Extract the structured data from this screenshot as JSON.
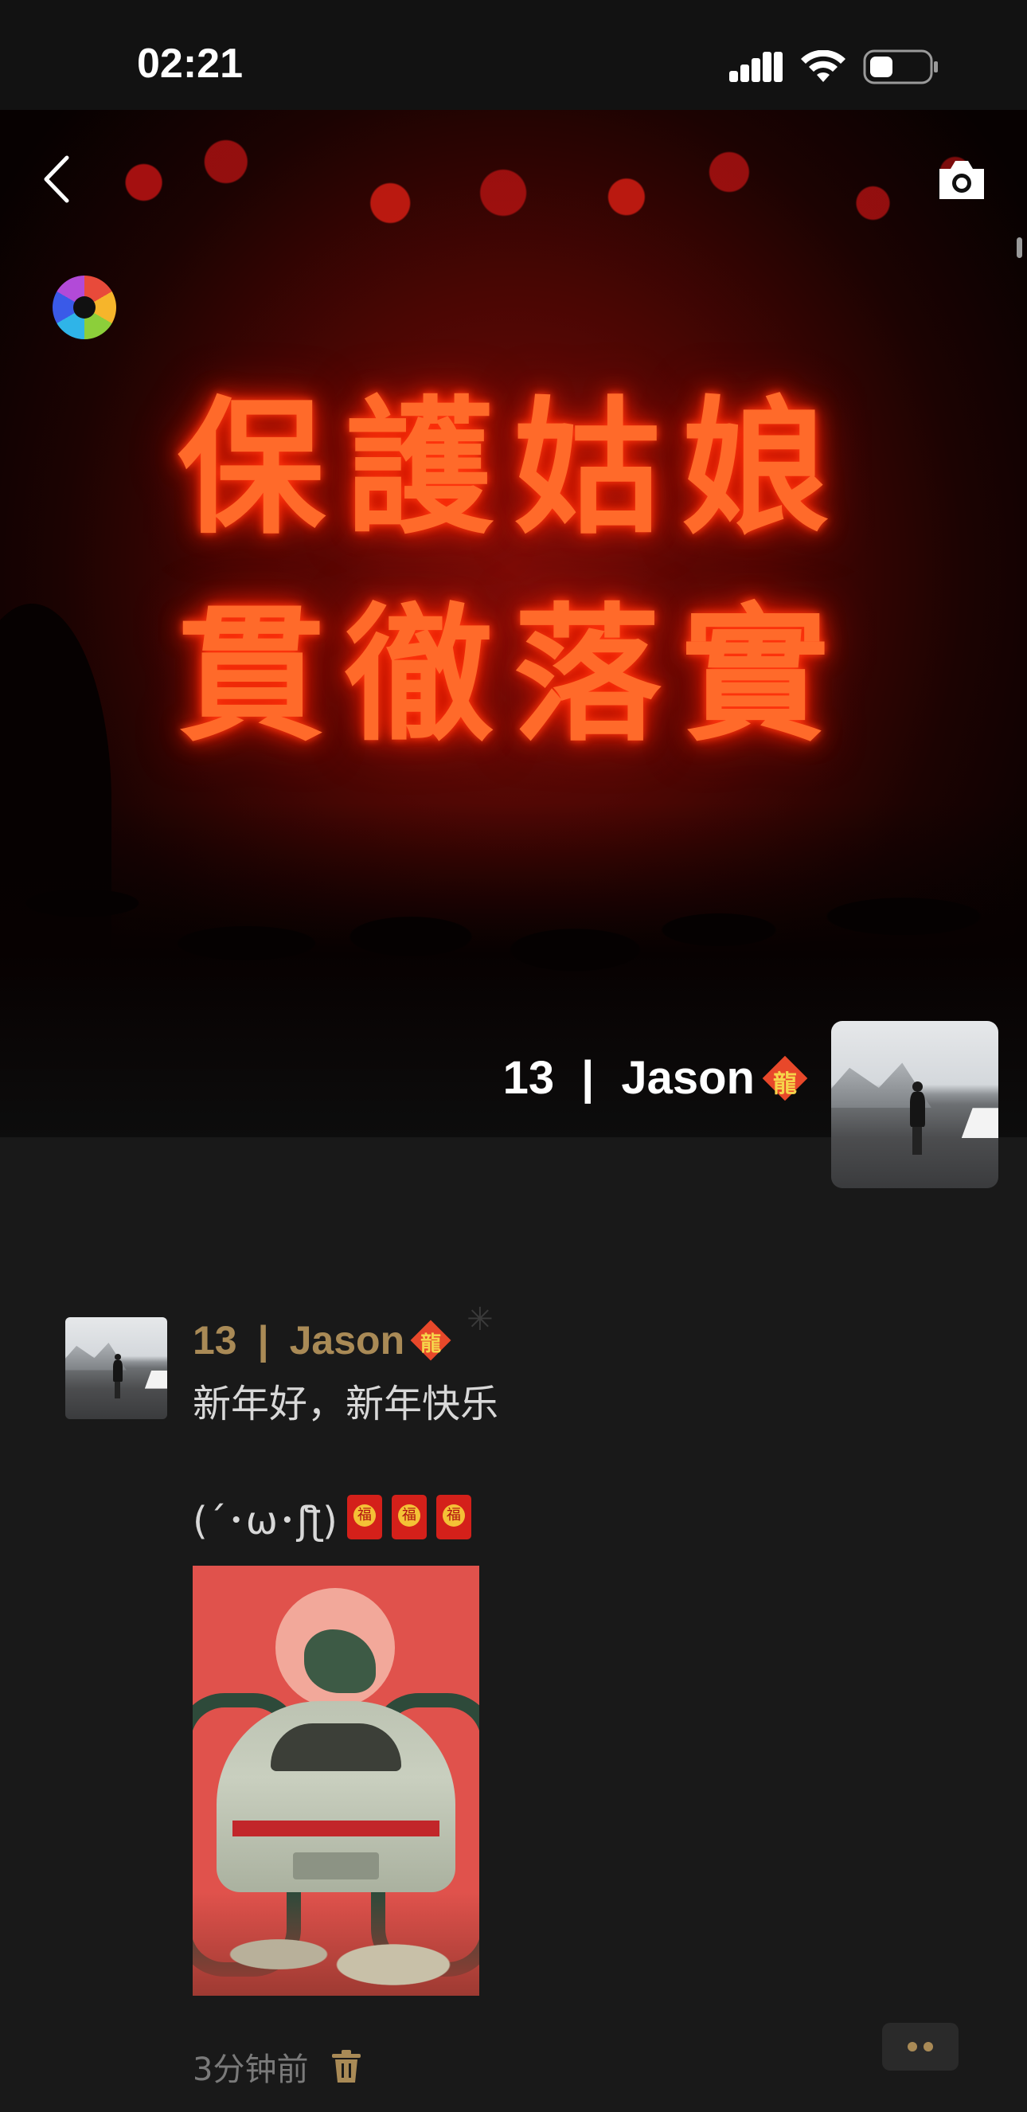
{
  "status_bar": {
    "time": "02:21"
  },
  "cover": {
    "neon_line_1": "保護姑娘",
    "neon_line_2": "貫徹落實",
    "count": "13",
    "separator": "|",
    "username": "Jason",
    "badge": "龍"
  },
  "post": {
    "count": "13",
    "separator": "|",
    "username": "Jason",
    "badge": "龍",
    "text": "新年好，新年快乐",
    "kaomoji": "(´･ω･ʃƪ)",
    "envelope_count": 3,
    "timestamp": "3分钟前"
  },
  "colors": {
    "background": "#191919",
    "name_gold": "#a98a56",
    "neon": "#ff6a2a"
  },
  "icons": {
    "back": "chevron-left-icon",
    "camera": "camera-icon",
    "aperture": "aperture-icon",
    "delete": "trash-icon",
    "more": "more-dots-icon"
  }
}
